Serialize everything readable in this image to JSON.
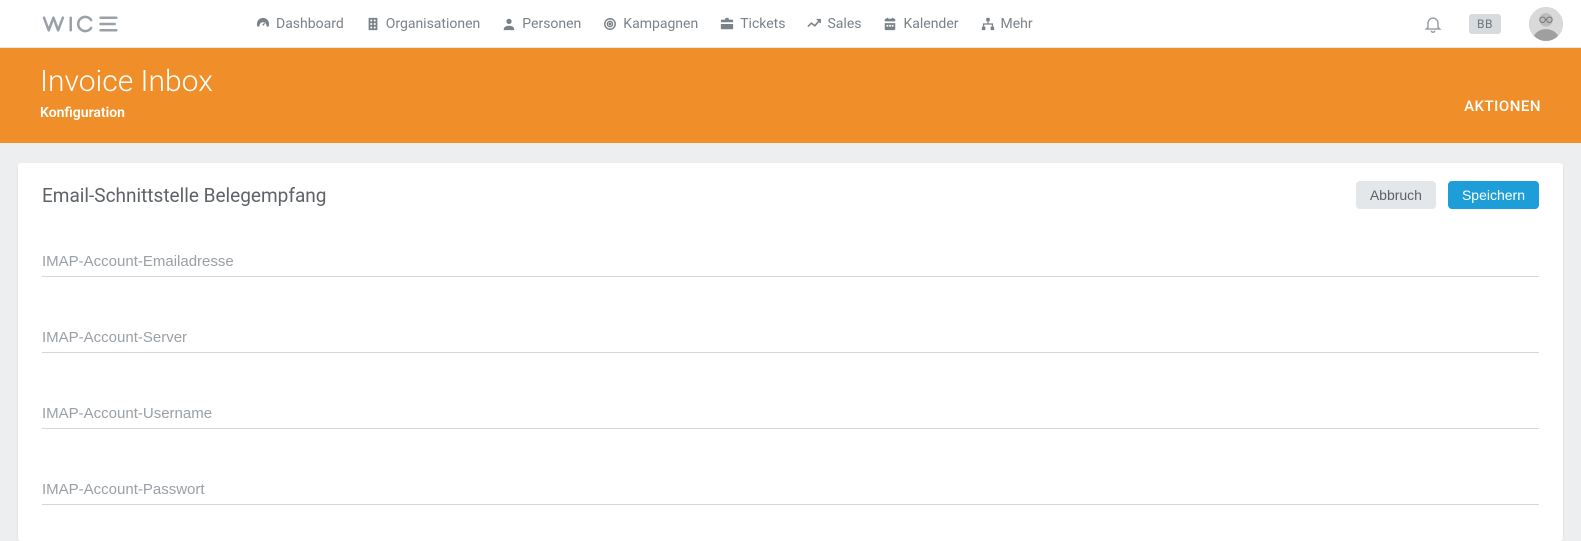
{
  "brand": "WICE",
  "nav": {
    "dashboard": "Dashboard",
    "organisationen": "Organisationen",
    "personen": "Personen",
    "kampagnen": "Kampagnen",
    "tickets": "Tickets",
    "sales": "Sales",
    "kalender": "Kalender",
    "mehr": "Mehr"
  },
  "user_badge": "BB",
  "header": {
    "title": "Invoice Inbox",
    "subtitle": "Konfiguration",
    "actions_label": "AKTIONEN"
  },
  "card": {
    "title": "Email-Schnittstelle Belegempfang",
    "cancel_label": "Abbruch",
    "save_label": "Speichern"
  },
  "form": {
    "email_placeholder": "IMAP-Account-Emailadresse",
    "server_placeholder": "IMAP-Account-Server",
    "username_placeholder": "IMAP-Account-Username",
    "password_placeholder": "IMAP-Account-Passwort",
    "email_value": "",
    "server_value": "",
    "username_value": "",
    "password_value": ""
  },
  "colors": {
    "accent_orange": "#f08f29",
    "accent_blue": "#1e9ed8"
  }
}
